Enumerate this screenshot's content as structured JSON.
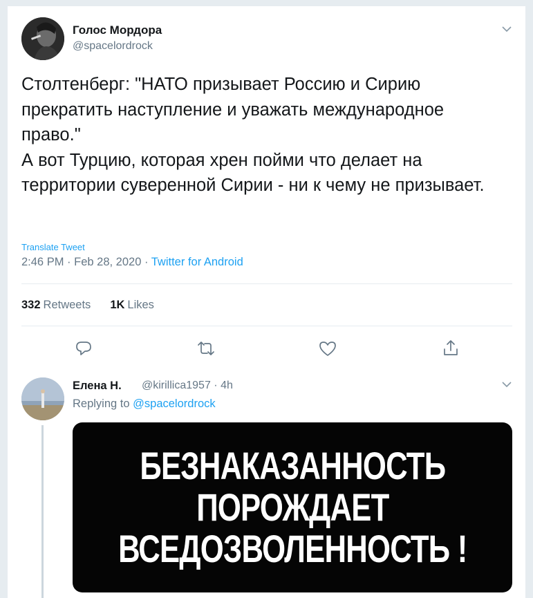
{
  "main_tweet": {
    "author_name": "Голос Мордора",
    "author_handle": "@spacelordrock",
    "text": "Столтенберг: \"НАТО призывает Россию и Сирию прекратить наступление и уважать международное право.\"\nА вот Турцию, которая хрен пойми что делает на территории суверенной Сирии - ни к чему не призывает.",
    "translate_label": "Translate Tweet",
    "time": "2:46 PM",
    "date": "Feb 28, 2020",
    "source": "Twitter for Android",
    "retweets_count": "332",
    "retweets_label": "Retweets",
    "likes_count": "1K",
    "likes_label": "Likes",
    "icons": [
      "reply-icon",
      "retweet-icon",
      "like-icon",
      "share-icon",
      "chevron-down-icon"
    ]
  },
  "reply_tweet": {
    "author_name": "Елена Н.",
    "author_handle": "@kirillica1957",
    "time_ago": "4h",
    "replying_to_label": "Replying to",
    "replying_to_handle": "@spacelordrock",
    "image_text_lines": [
      "БЕЗНАКАЗАННОСТЬ",
      "ПОРОЖДАЕТ",
      "ВСЕДОЗВОЛЕННОСТЬ !"
    ]
  },
  "colors": {
    "accent": "#1da1f2",
    "secondary_text": "#657786",
    "primary_text": "#14171a",
    "divider": "#e6ecf0"
  }
}
